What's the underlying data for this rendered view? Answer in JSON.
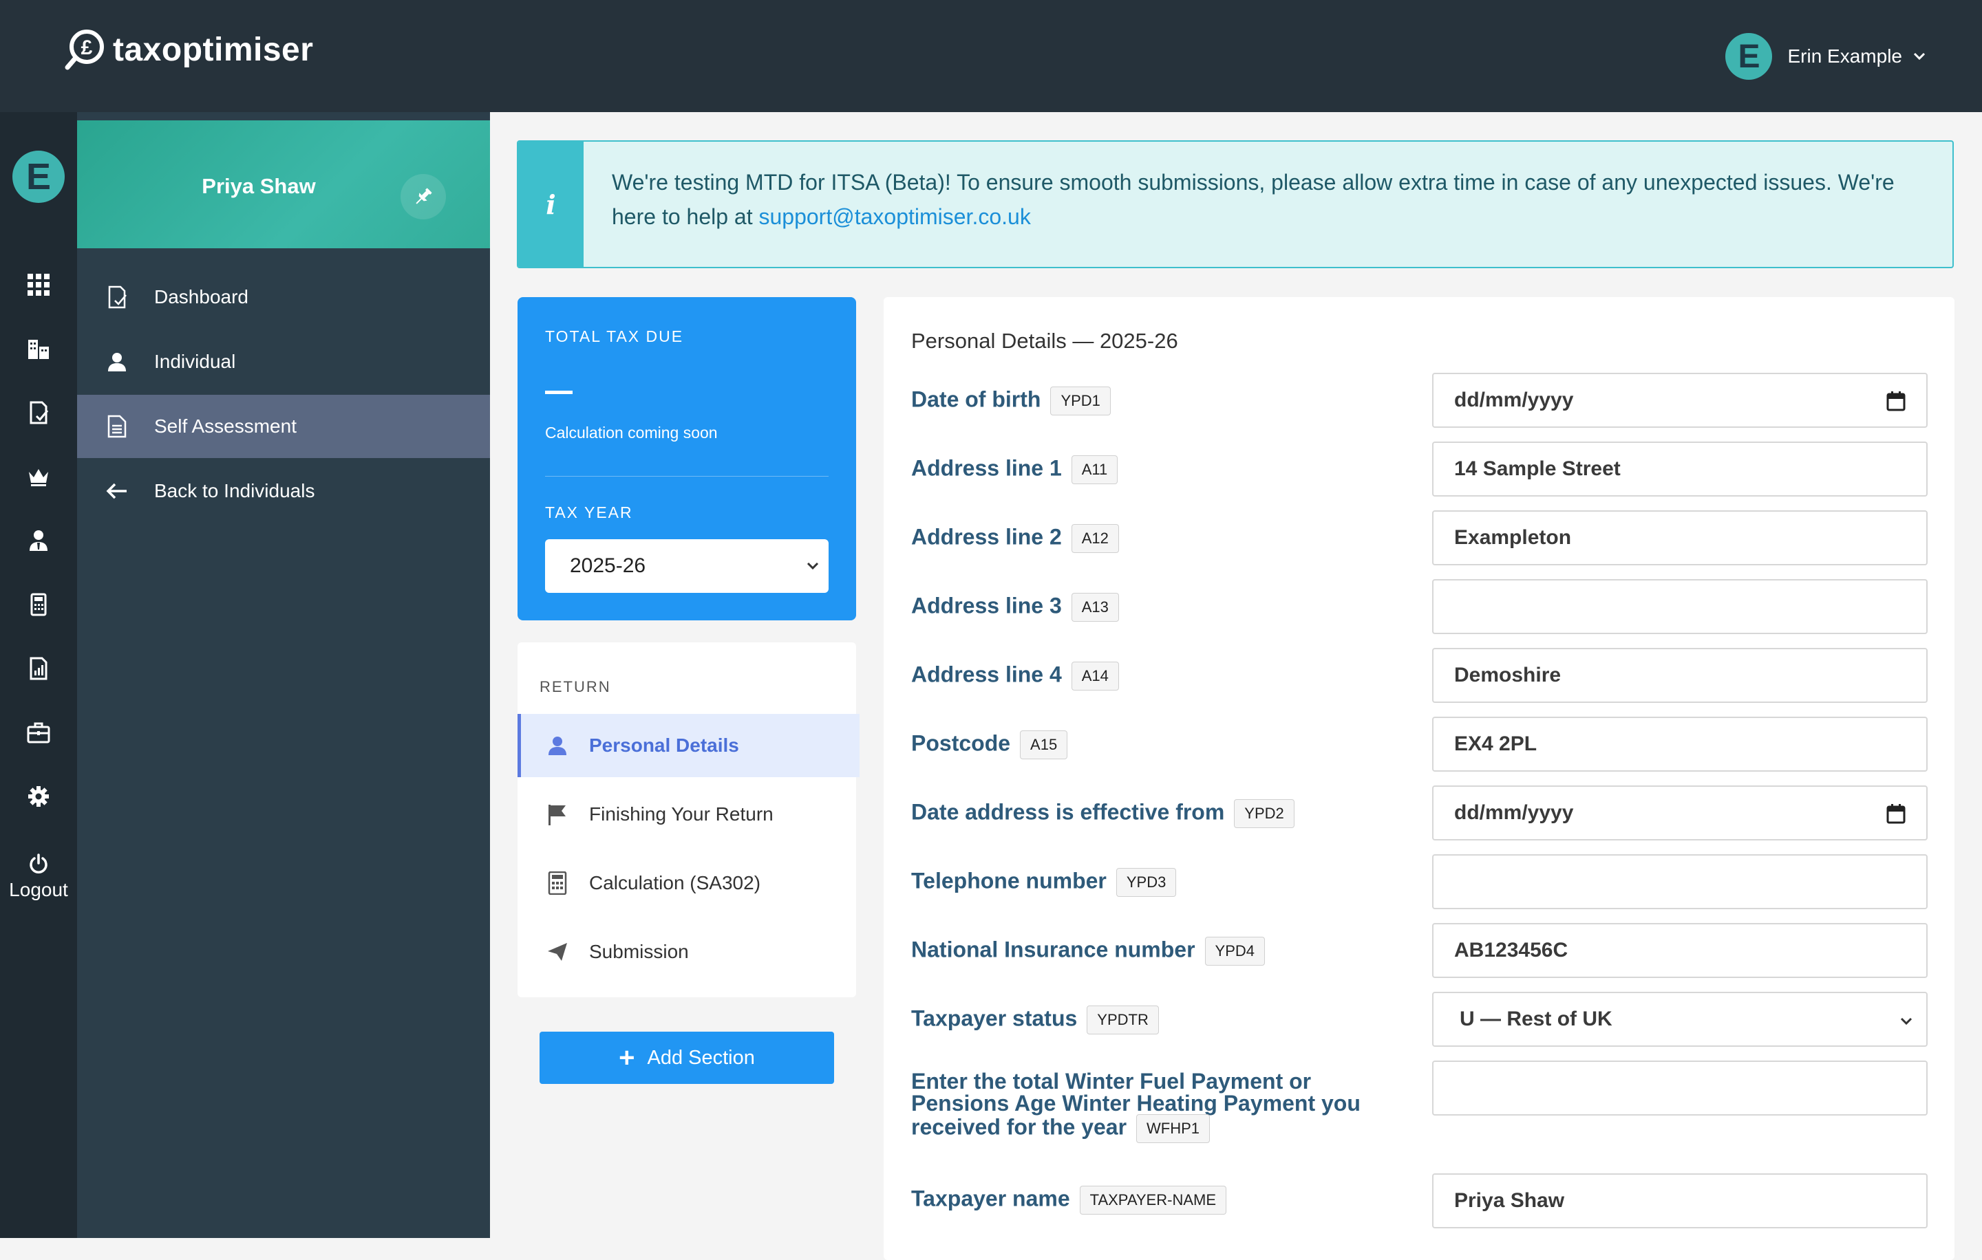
{
  "app": {
    "name": "taxoptimiser",
    "user": {
      "initial": "E",
      "name": "Erin Example"
    }
  },
  "rail": {
    "initial": "E",
    "logout_label": "Logout"
  },
  "sidebar": {
    "client_name": "Priya Shaw",
    "items": [
      {
        "label": "Dashboard",
        "icon": "document-check-icon"
      },
      {
        "label": "Individual",
        "icon": "person-icon"
      },
      {
        "label": "Self Assessment",
        "icon": "document-icon",
        "active": true
      },
      {
        "label": "Back to Individuals",
        "icon": "arrow-left-icon"
      }
    ]
  },
  "banner": {
    "text": "We're testing MTD for ITSA (Beta)! To ensure smooth submissions, please allow extra time in case of any unexpected issues. We're here to help at ",
    "link": "support@taxoptimiser.co.uk"
  },
  "tax_card": {
    "total_label": "TOTAL TAX DUE",
    "calc_note": "Calculation coming soon",
    "year_label": "TAX YEAR",
    "year_value": "2025-26"
  },
  "return_nav": {
    "label": "RETURN",
    "items": [
      {
        "label": "Personal Details",
        "icon": "person-icon",
        "active": true
      },
      {
        "label": "Finishing Your Return",
        "icon": "flag-icon"
      },
      {
        "label": "Calculation (SA302)",
        "icon": "calculator-icon"
      },
      {
        "label": "Submission",
        "icon": "paper-plane-icon"
      }
    ],
    "add_button": "Add Section"
  },
  "form": {
    "title": "Personal Details — 2025-26",
    "rows": [
      {
        "label": "Date of birth",
        "code": "YPD1",
        "value": "dd/mm/yyyy",
        "type": "date"
      },
      {
        "label": "Address line 1",
        "code": "A11",
        "value": "14 Sample Street",
        "type": "text"
      },
      {
        "label": "Address line 2",
        "code": "A12",
        "value": "Exampleton",
        "type": "text"
      },
      {
        "label": "Address line 3",
        "code": "A13",
        "value": "",
        "type": "text"
      },
      {
        "label": "Address line 4",
        "code": "A14",
        "value": "Demoshire",
        "type": "text"
      },
      {
        "label": "Postcode",
        "code": "A15",
        "value": "EX4 2PL",
        "type": "text"
      },
      {
        "label": "Date address is effective from",
        "code": "YPD2",
        "value": "dd/mm/yyyy",
        "type": "date"
      },
      {
        "label": "Telephone number",
        "code": "YPD3",
        "value": "",
        "type": "text"
      },
      {
        "label": "National Insurance number",
        "code": "YPD4",
        "value": "AB123456C",
        "type": "text"
      },
      {
        "label": "Taxpayer status",
        "code": "YPDTR",
        "value": "U — Rest of UK",
        "type": "select"
      },
      {
        "label": "Enter the total Winter Fuel Payment or Pensions Age Winter Heating Payment you received for the year",
        "code": "WFHP1",
        "value": "",
        "type": "text"
      },
      {
        "label": "Taxpayer name",
        "code": "TAXPAYER-NAME",
        "value": "Priya Shaw",
        "type": "text"
      }
    ]
  },
  "colors": {
    "topbar": "#26323b",
    "rail": "#1f2a32",
    "sidebar": "#2c3e4a",
    "teal": "#3cb8a8",
    "primary": "#2196f3",
    "label": "#2e5a7a"
  }
}
